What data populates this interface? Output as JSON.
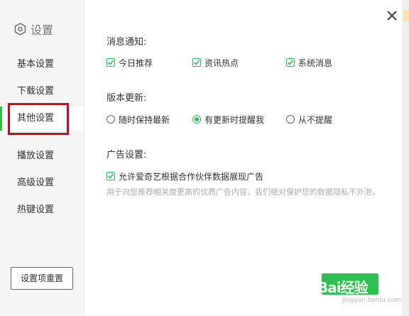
{
  "sidebar": {
    "title": "设置",
    "items": [
      {
        "label": "基本设置"
      },
      {
        "label": "下载设置"
      },
      {
        "label": "其他设置"
      },
      {
        "label": "播放设置"
      },
      {
        "label": "高级设置"
      },
      {
        "label": "热键设置"
      }
    ],
    "active_index": 2,
    "reset_label": "设置项重置"
  },
  "sections": {
    "notify": {
      "title": "消息通知:",
      "options": [
        {
          "label": "今日推荐",
          "checked": true
        },
        {
          "label": "资讯热点",
          "checked": true
        },
        {
          "label": "系统消息",
          "checked": true
        }
      ]
    },
    "update": {
      "title": "版本更新:",
      "options": [
        {
          "label": "随时保持最新",
          "selected": false
        },
        {
          "label": "有更新时提醒我",
          "selected": true
        },
        {
          "label": "从不提醒",
          "selected": false
        }
      ]
    },
    "ads": {
      "title": "广告设置:",
      "option": {
        "label": "允许爱奇艺根据合作伙伴数据展现广告",
        "checked": true
      },
      "note": "用于向您推荐相关度更高的优质广告内容，我们绝对保护您的数据隐私不外泄。"
    }
  },
  "watermark": {
    "text": "Bai经验",
    "sub": "jingyan.baidu.com"
  },
  "colors": {
    "accent": "#2fbf51",
    "highlight": "#d9001b"
  },
  "icons": {
    "settings": "hexagon-gear-icon",
    "close": "close-icon",
    "check": "check-icon"
  }
}
